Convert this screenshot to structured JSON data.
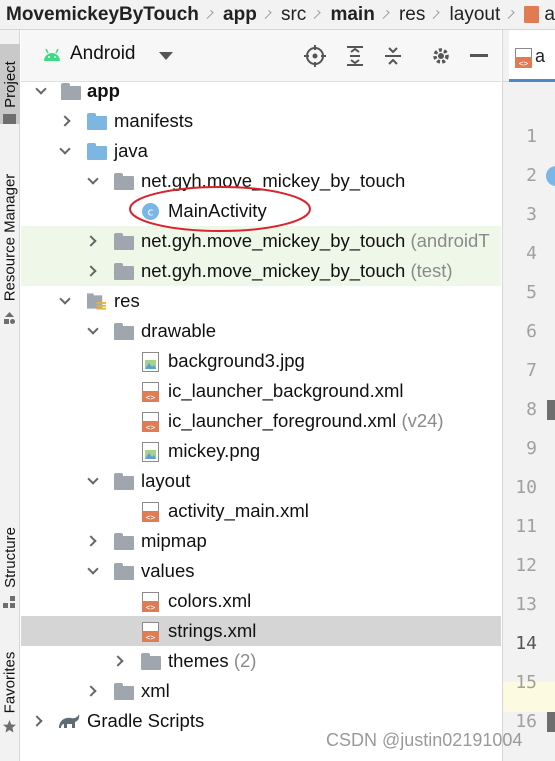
{
  "breadcrumb": {
    "items": [
      "MovemickeyByTouch",
      "app",
      "src",
      "main",
      "res",
      "layout",
      "a"
    ]
  },
  "tool_strip": {
    "project_tab": "Project",
    "resource_manager_tab": "Resource Manager",
    "structure_tab": "Structure",
    "favorites_tab": "Favorites"
  },
  "project_view": {
    "view_label": "Android",
    "header_icons": [
      "locate-icon",
      "expand-all-icon",
      "collapse-all-icon",
      "settings-icon",
      "hide-icon"
    ]
  },
  "tree": {
    "app": "app",
    "manifests": "manifests",
    "java": "java",
    "pkg_main": "net.gyh.move_mickey_by_touch",
    "main_activity": "MainActivity",
    "pkg_android_test": "net.gyh.move_mickey_by_touch",
    "pkg_android_test_suffix": "(androidT",
    "pkg_test": "net.gyh.move_mickey_by_touch",
    "pkg_test_suffix": "(test)",
    "res": "res",
    "drawable": "drawable",
    "background3": "background3.jpg",
    "ic_launcher_background": "ic_launcher_background.xml",
    "ic_launcher_foreground": "ic_launcher_foreground.xml",
    "ic_launcher_foreground_suffix": "(v24)",
    "mickey": "mickey.png",
    "layout": "layout",
    "activity_main": "activity_main.xml",
    "mipmap": "mipmap",
    "values": "values",
    "colors": "colors.xml",
    "strings": "strings.xml",
    "themes": "themes",
    "themes_suffix": "(2)",
    "xml": "xml",
    "gradle_scripts": "Gradle Scripts"
  },
  "editor": {
    "line_numbers": [
      "1",
      "2",
      "3",
      "4",
      "5",
      "6",
      "7",
      "8",
      "9",
      "10",
      "11",
      "12",
      "13",
      "14",
      "15",
      "16"
    ],
    "current_line": "14"
  },
  "watermark": "CSDN @justin02191004",
  "colors": {
    "selected_row": "#d5d5d5",
    "highlight_green": "#eef7e8",
    "annotation_circle": "#d9232e",
    "xml_icon": "#e07b53",
    "folder_blue": "#7eb6e2",
    "folder_gray": "#9fa6ad"
  }
}
